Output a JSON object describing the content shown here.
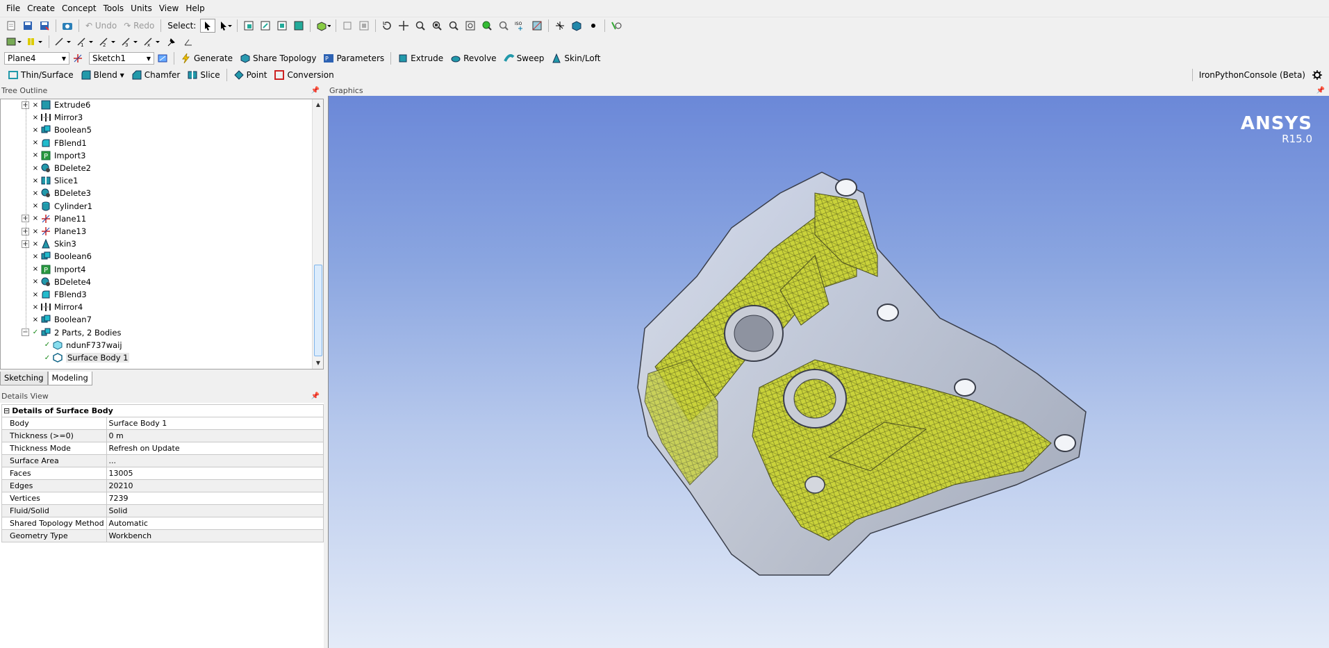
{
  "menu": [
    "File",
    "Create",
    "Concept",
    "Tools",
    "Units",
    "View",
    "Help"
  ],
  "toolbar1": {
    "undo": "Undo",
    "redo": "Redo",
    "select": "Select:"
  },
  "toolbar3": {
    "plane": "Plane4",
    "sketch": "Sketch1",
    "generate": "Generate",
    "share_topology": "Share Topology",
    "parameters": "Parameters",
    "extrude": "Extrude",
    "revolve": "Revolve",
    "sweep": "Sweep",
    "skin_loft": "Skin/Loft"
  },
  "toolbar4": {
    "thin_surface": "Thin/Surface",
    "blend": "Blend",
    "chamfer": "Chamfer",
    "slice": "Slice",
    "point": "Point",
    "conversion": "Conversion",
    "console": "IronPythonConsole (Beta)"
  },
  "tree": {
    "title": "Tree Outline",
    "items": [
      {
        "label": "Extrude6",
        "icon": "extrude-icon",
        "expandable": true
      },
      {
        "label": "Mirror3",
        "icon": "mirror-icon",
        "expandable": false
      },
      {
        "label": "Boolean5",
        "icon": "boolean-icon",
        "expandable": false
      },
      {
        "label": "FBlend1",
        "icon": "blend-icon",
        "expandable": false
      },
      {
        "label": "Import3",
        "icon": "import-icon",
        "expandable": false
      },
      {
        "label": "BDelete2",
        "icon": "body-delete-icon",
        "expandable": false
      },
      {
        "label": "Slice1",
        "icon": "slice-icon",
        "expandable": false
      },
      {
        "label": "BDelete3",
        "icon": "body-delete-icon",
        "expandable": false
      },
      {
        "label": "Cylinder1",
        "icon": "cylinder-icon",
        "expandable": false
      },
      {
        "label": "Plane11",
        "icon": "plane-icon",
        "expandable": true
      },
      {
        "label": "Plane13",
        "icon": "plane-icon",
        "expandable": true
      },
      {
        "label": "Skin3",
        "icon": "skin-icon",
        "expandable": true
      },
      {
        "label": "Boolean6",
        "icon": "boolean-icon",
        "expandable": false
      },
      {
        "label": "Import4",
        "icon": "import-icon",
        "expandable": false
      },
      {
        "label": "BDelete4",
        "icon": "body-delete-icon",
        "expandable": false
      },
      {
        "label": "FBlend3",
        "icon": "blend-icon",
        "expandable": false
      },
      {
        "label": "Mirror4",
        "icon": "mirror-icon",
        "expandable": false
      },
      {
        "label": "Boolean7",
        "icon": "boolean-icon",
        "expandable": false
      },
      {
        "label": "2 Parts, 2 Bodies",
        "icon": "parts-icon",
        "expandable": true,
        "expanded": true
      },
      {
        "label": "ndunF737waij",
        "icon": "solid-body-icon",
        "child": true
      },
      {
        "label": "Surface Body 1",
        "icon": "surface-body-icon",
        "child": true,
        "selected": true
      }
    ]
  },
  "tabs": [
    "Sketching",
    "Modeling"
  ],
  "details": {
    "title": "Details View",
    "header": "Details of Surface Body",
    "rows": [
      {
        "k": "Body",
        "v": "Surface Body 1"
      },
      {
        "k": "Thickness (>=0)",
        "v": "0 m"
      },
      {
        "k": "Thickness Mode",
        "v": "Refresh on Update"
      },
      {
        "k": "Surface Area",
        "v": "..."
      },
      {
        "k": "Faces",
        "v": "13005"
      },
      {
        "k": "Edges",
        "v": "20210"
      },
      {
        "k": "Vertices",
        "v": "7239"
      },
      {
        "k": "Fluid/Solid",
        "v": "Solid"
      },
      {
        "k": "Shared Topology Method",
        "v": "Automatic"
      },
      {
        "k": "Geometry Type",
        "v": "Workbench"
      }
    ]
  },
  "graphics": {
    "title": "Graphics",
    "brand": "ANSYS",
    "version": "R15.0"
  },
  "colors": {
    "accent": "#1f7fbf",
    "mesh": "#c9d23a",
    "bg_top": "#6b88d8",
    "bg_bottom": "#e4ebf8"
  }
}
